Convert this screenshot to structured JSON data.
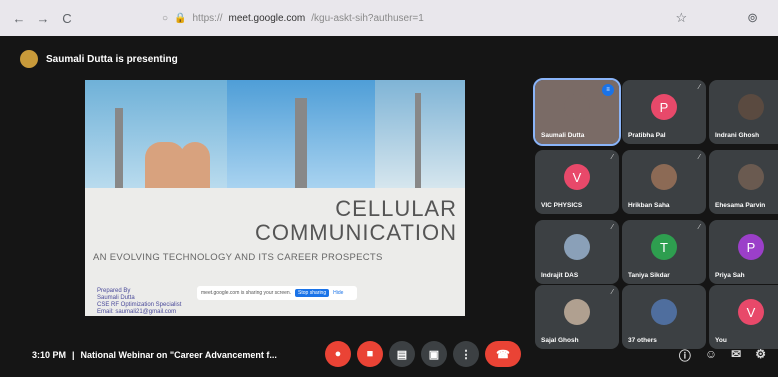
{
  "browser": {
    "back": "←",
    "forward": "→",
    "reload": "C",
    "url_host": "meet.google.com",
    "url_path": "/kgu-askt-sih?authuser=1",
    "url_prefix": "https://",
    "star": "☆",
    "profile": "⊚"
  },
  "presenting": {
    "text": "Saumali Dutta is presenting"
  },
  "slide": {
    "title_line1": "CELLULAR",
    "title_line2": "COMMUNICATION",
    "subtitle": "AN EVOLVING TECHNOLOGY AND ITS CAREER PROSPECTS",
    "prepared_by": [
      "Prepared By",
      "Saumali Dutta",
      "CSE RF Optimization Specialist",
      "Email: saumali21@gmail.com"
    ],
    "share_notice": "meet.google.com is sharing your screen.",
    "stop_sharing": "Stop sharing",
    "hide": "Hide"
  },
  "tiles": [
    {
      "name": "Saumali Dutta",
      "initial": "",
      "color": "#7a6b66",
      "icon": "speaking-icon",
      "active": true
    },
    {
      "name": "Pratibha Pal",
      "initial": "P",
      "color": "#e8496a",
      "icon": "mic-off-icon"
    },
    {
      "name": "Indrani Ghosh",
      "initial": "",
      "color": "#5a4a40",
      "icon": "mic-off-icon"
    },
    {
      "name": "VIC PHYSICS",
      "initial": "V",
      "color": "#e8496a",
      "icon": "mic-off-icon"
    },
    {
      "name": "Hrikban Saha",
      "initial": "",
      "color": "#8c6a55",
      "icon": "mic-off-icon"
    },
    {
      "name": "Ehesama Parvin",
      "initial": "",
      "color": "#6a5a50",
      "icon": "mic-off-icon"
    },
    {
      "name": "Indrajit DAS",
      "initial": "",
      "color": "#8aa0b8",
      "icon": "mic-off-icon"
    },
    {
      "name": "Taniya Sikdar",
      "initial": "T",
      "color": "#2e9e4f",
      "icon": "mic-off-icon"
    },
    {
      "name": "Priya Sah",
      "initial": "P",
      "color": "#9b3fc9",
      "icon": "mic-off-icon"
    },
    {
      "name": "Sajal Ghosh",
      "initial": "",
      "color": "#b0a090",
      "icon": "mic-off-icon"
    },
    {
      "name": "37 others",
      "initial": "",
      "color": "#4f6e9e",
      "icon": ""
    },
    {
      "name": "You",
      "initial": "V",
      "color": "#e8496a",
      "icon": ""
    }
  ],
  "bottom": {
    "time": "3:10 PM",
    "separator": "|",
    "meeting_title": "National Webinar on \"Career Advancement f...",
    "icons": [
      "mic-off-icon",
      "camera-off-icon",
      "captions-icon",
      "present-icon",
      "more-icon",
      "end-call-icon"
    ],
    "right_icons": [
      "info-icon",
      "people-icon",
      "chat-icon",
      "activities-icon"
    ],
    "accent_red": "#ea4335",
    "control_dark": "#3c4043"
  }
}
